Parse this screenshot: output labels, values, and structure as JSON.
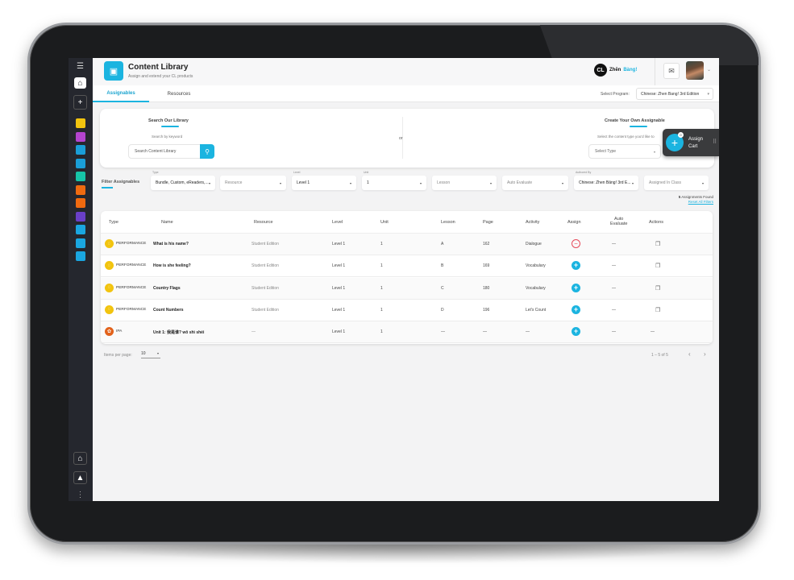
{
  "app": {
    "title": "Content Library",
    "subtitle": "Assign and extend your CL products",
    "brand_logo": "CL",
    "brand_name_1": "Zhēn",
    "brand_name_2": "Bàng!"
  },
  "rail": {
    "icons": [
      "menu-collapse-icon",
      "home-icon",
      "plus-icon"
    ],
    "menu_glyph": "☰",
    "home_glyph": "⌂",
    "plus_glyph": "+",
    "swatches": [
      "#f2c40f",
      "#b444d0",
      "#1a9ed8",
      "#1a9ed8",
      "#16c4a8",
      "#f06a10",
      "#f06a10",
      "#6a3fc8",
      "#1aa6e0",
      "#1aa6e0",
      "#1aa6e0"
    ],
    "bottom_icons": [
      "backpack-icon",
      "upload-icon",
      "more-vertical-icon"
    ],
    "bottom_glyphs": [
      "⌂",
      "▲",
      "⋮"
    ]
  },
  "header": {
    "mail_glyph": "✉",
    "avatar_caret": "⌄"
  },
  "tabs": [
    {
      "label": "Assignables",
      "active": true
    },
    {
      "label": "Resources",
      "active": false
    }
  ],
  "program": {
    "label": "Select Program:",
    "value": "Chinese: Zhen Bang! 3rd Edition",
    "caret": "▾"
  },
  "search_library": {
    "heading": "Search Our Library",
    "hint": "Search by keyword",
    "placeholder": "Search Content Library",
    "button_glyph": "⚲"
  },
  "or_label": "or",
  "create_own": {
    "heading": "Create Your Own Assignable",
    "hint": "Select the content type you'd like to",
    "select_placeholder": "Select Type",
    "caret": "▾"
  },
  "assign_cart": {
    "label_1": "Assign",
    "label_2": "Cart",
    "count": "0",
    "plus": "+",
    "grip": "⠿"
  },
  "filters": {
    "label": "Filter Assignables",
    "items": [
      {
        "caption": "Type",
        "value": "Bundle, Custom, eReaders,...",
        "has_value": true
      },
      {
        "caption": "",
        "value": "Resource",
        "has_value": false
      },
      {
        "caption": "Level",
        "value": "Level 1",
        "has_value": true
      },
      {
        "caption": "Unit",
        "value": "1",
        "has_value": true
      },
      {
        "caption": "",
        "value": "Lesson",
        "has_value": false
      },
      {
        "caption": "",
        "value": "Auto Evaluate",
        "has_value": false
      },
      {
        "caption": "Authored By",
        "value": "Chinese: Zhen Bāng! 3rd E...",
        "has_value": true
      },
      {
        "caption": "",
        "value": "Assigned In Class",
        "has_value": false
      }
    ],
    "caret": "▾",
    "found_count": "5",
    "found_label": "Assignments Found",
    "reset_label": "Reset All Filters"
  },
  "table": {
    "columns": [
      "Type",
      "Name",
      "Resource",
      "Level",
      "Unit",
      "Lesson",
      "Page",
      "Activity",
      "Assign",
      "Auto Evaluate",
      "Actions"
    ],
    "auto_eval_1": "Auto",
    "auto_eval_2": "Evaluate",
    "rows": [
      {
        "type": "PERFORMANCE",
        "type_icon": "chat-bubble-icon",
        "icon_color": "#f2c40f",
        "name": "What is his name?",
        "resource": "Student Edition",
        "level": "Level 1",
        "unit": "1",
        "lesson": "A",
        "page": "162",
        "activity": "Dialogue",
        "assign": "remove",
        "auto_evaluate": "—",
        "action": "copy"
      },
      {
        "type": "PERFORMANCE",
        "type_icon": "chat-bubble-icon",
        "icon_color": "#f2c40f",
        "name": "How is she feeling?",
        "resource": "Student Edition",
        "level": "Level 1",
        "unit": "1",
        "lesson": "B",
        "page": "169",
        "activity": "Vocabulary",
        "assign": "add",
        "auto_evaluate": "—",
        "action": "copy"
      },
      {
        "type": "PERFORMANCE",
        "type_icon": "chat-bubble-icon",
        "icon_color": "#f2c40f",
        "name": "Country Flags",
        "resource": "Student Edition",
        "level": "Level 1",
        "unit": "1",
        "lesson": "C",
        "page": "180",
        "activity": "Vocabulary",
        "assign": "add",
        "auto_evaluate": "—",
        "action": "copy"
      },
      {
        "type": "PERFORMANCE",
        "type_icon": "chat-bubble-icon",
        "icon_color": "#f2c40f",
        "name": "Count Numbers",
        "resource": "Student Edition",
        "level": "Level 1",
        "unit": "1",
        "lesson": "D",
        "page": "196",
        "activity": "Let's Count",
        "assign": "add",
        "auto_evaluate": "—",
        "action": "copy"
      },
      {
        "type": "IPA",
        "type_icon": "puzzle-icon",
        "icon_color": "#e2621b",
        "name": "Unit 1: 我是谁? wǒ shì shéi",
        "resource": "—",
        "level": "Level 1",
        "unit": "1",
        "lesson": "—",
        "page": "—",
        "activity": "—",
        "assign": "add",
        "auto_evaluate": "—",
        "action": "—"
      }
    ],
    "copy_glyph": "❐",
    "add_glyph": "+",
    "remove_glyph": "−"
  },
  "pagination": {
    "items_per_page_label": "Items per page:",
    "items_per_page_value": "10",
    "caret": "▾",
    "range": "1 – 5 of 5",
    "prev": "‹",
    "next": "›"
  }
}
